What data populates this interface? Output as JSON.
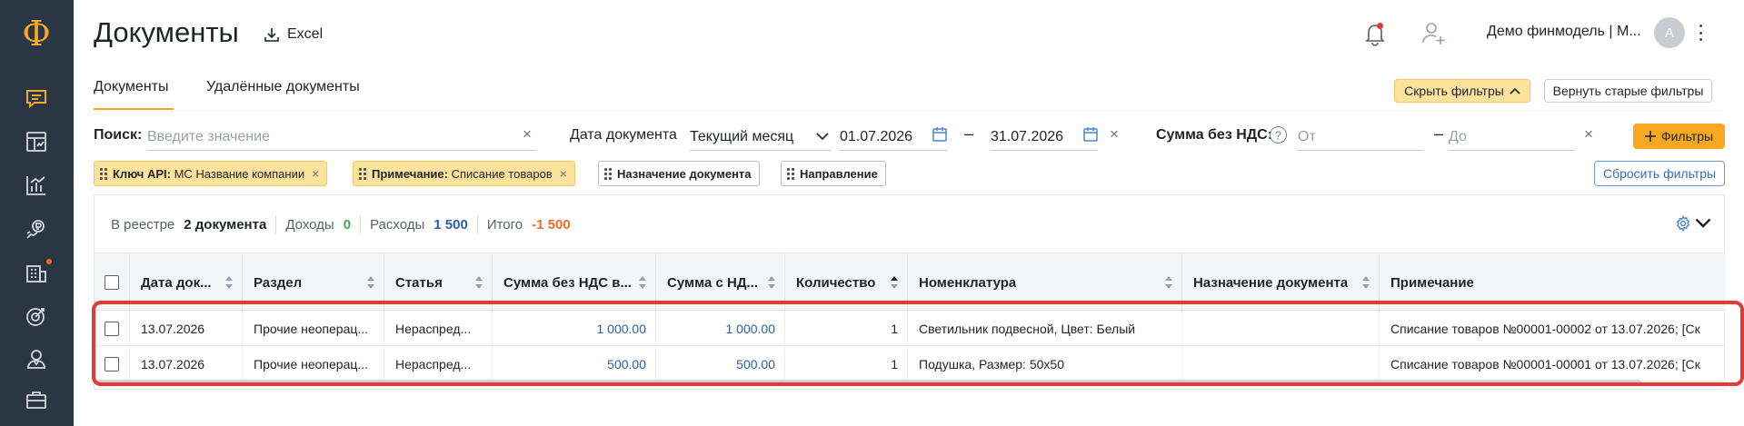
{
  "sidebar": {
    "logo": "Ф",
    "items": [
      {
        "icon": "chat-icon",
        "active": true
      },
      {
        "icon": "dashboard-icon"
      },
      {
        "icon": "chart-icon"
      },
      {
        "icon": "payments-icon"
      },
      {
        "icon": "building-icon",
        "badge": true
      },
      {
        "icon": "target-icon"
      },
      {
        "icon": "users-icon"
      },
      {
        "icon": "briefcase-icon"
      }
    ]
  },
  "header": {
    "title": "Документы",
    "excel_label": "Excel",
    "workspace": "Демо финмодель | М...",
    "avatar_initial": "А"
  },
  "tabs": [
    {
      "label": "Документы",
      "active": true
    },
    {
      "label": "Удалённые документы",
      "active": false
    }
  ],
  "filter_buttons": {
    "hide_filters": "Скрыть фильтры",
    "old_filters": "Вернуть старые фильтры",
    "filters": "Фильтры",
    "reset_filters": "Сбросить фильтры"
  },
  "filters": {
    "search_label": "Поиск:",
    "search_placeholder": "Введите значение",
    "date_label": "Дата документа",
    "date_period": "Текущий месяц",
    "date_from": "01.07.2026",
    "date_to": "31.07.2026",
    "dash": "–",
    "sum_label": "Сумма без НДС:",
    "help": "?",
    "sum_from_placeholder": "От",
    "sum_to_placeholder": "До",
    "clear": "×"
  },
  "chips": [
    {
      "key": "Ключ API:",
      "value": "МС Название компании",
      "active": true
    },
    {
      "key": "Примечание:",
      "value": "Списание товаров",
      "active": true
    },
    {
      "key": "Назначение документа",
      "value": "",
      "active": false
    },
    {
      "key": "Направление",
      "value": "",
      "active": false
    }
  ],
  "summary": {
    "registry_label": "В реестре",
    "registry_value": "2 документа",
    "income_label": "Доходы",
    "income_value": "0",
    "expense_label": "Расходы",
    "expense_value": "1 500",
    "total_label": "Итого",
    "total_value": "-1 500"
  },
  "colors": {
    "accent": "#f7a823",
    "sidebar": "#2b3645",
    "income": "#3aa84a",
    "expense": "#2b5ea7",
    "total": "#f36b21",
    "highlight": "#e53935"
  },
  "table": {
    "columns": [
      "Дата док...",
      "Раздел",
      "Статья",
      "Сумма без НДС в...",
      "Сумма с НД...",
      "Количество",
      "Номенклатура",
      "Назначение документа",
      "Примечание"
    ],
    "rows": [
      {
        "date": "13.07.2026",
        "section": "Прочие неоперац...",
        "article": "Нераспред...",
        "sum_no_vat": "1 000.00",
        "sum_vat": "1 000.00",
        "qty": "1",
        "nomenclature": "Светильник подвесной, Цвет: Белый",
        "purpose": "",
        "note": "Списание товаров №00001-00002 от 13.07.2026; [Ск"
      },
      {
        "date": "13.07.2026",
        "section": "Прочие неоперац...",
        "article": "Нераспред...",
        "sum_no_vat": "500.00",
        "sum_vat": "500.00",
        "qty": "1",
        "nomenclature": "Подушка, Размер: 50x50",
        "purpose": "",
        "note": "Списание товаров №00001-00001 от 13.07.2026; [Ск"
      }
    ]
  }
}
